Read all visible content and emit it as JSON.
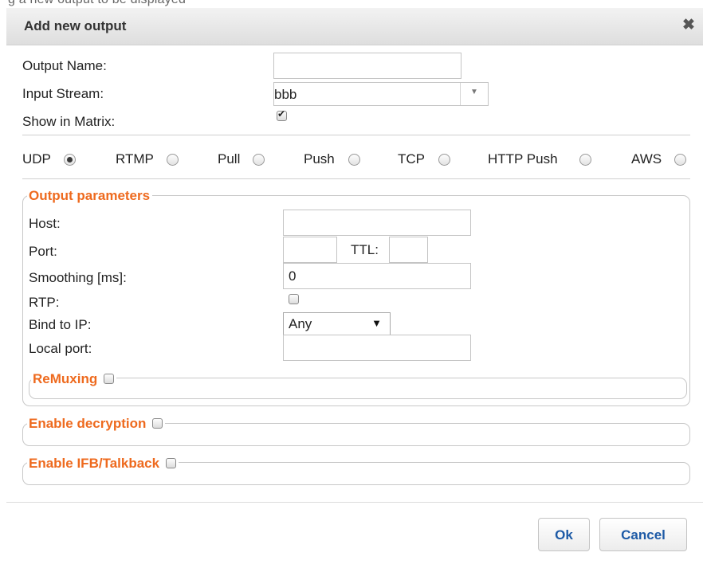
{
  "background_text": "g a new output to be displayed",
  "dialog": {
    "title": "Add new output",
    "close_icon": "close-icon"
  },
  "form": {
    "output_name_label": "Output Name:",
    "output_name_value": "",
    "input_stream_label": "Input Stream:",
    "input_stream_value": "bbb",
    "show_in_matrix_label": "Show in Matrix:",
    "show_in_matrix_checked": true
  },
  "protocols": [
    {
      "label": "UDP",
      "selected": true
    },
    {
      "label": "RTMP",
      "selected": false
    },
    {
      "label": "Pull",
      "selected": false
    },
    {
      "label": "Push",
      "selected": false
    },
    {
      "label": "TCP",
      "selected": false
    },
    {
      "label": "HTTP Push",
      "selected": false
    },
    {
      "label": "AWS",
      "selected": false
    }
  ],
  "output_parameters": {
    "legend": "Output parameters",
    "host_label": "Host:",
    "host_value": "",
    "port_label": "Port:",
    "port_value": "",
    "ttl_label": "TTL:",
    "ttl_value": "",
    "smoothing_label": "Smoothing [ms]:",
    "smoothing_value": "0",
    "rtp_label": "RTP:",
    "rtp_checked": false,
    "bind_ip_label": "Bind to IP:",
    "bind_ip_value": "Any",
    "local_port_label": "Local port:",
    "local_port_value": "",
    "remuxing_legend": "ReMuxing"
  },
  "sections": {
    "decryption_legend": "Enable decryption",
    "ifb_legend": "Enable IFB/Talkback"
  },
  "buttons": {
    "ok": "Ok",
    "cancel": "Cancel"
  },
  "colors": {
    "accent_orange": "#ee6a1e",
    "button_text_blue": "#1d5aa6"
  }
}
